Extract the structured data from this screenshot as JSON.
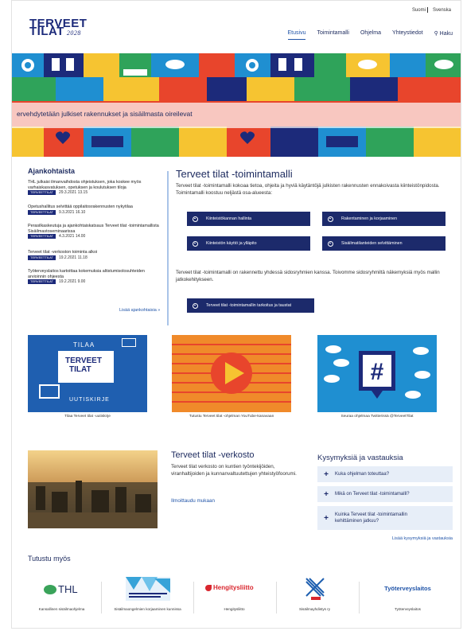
{
  "lang": {
    "fi": "Suomi",
    "sv": "Svenska"
  },
  "logo": {
    "line1": "TERVEET",
    "line2": "TILAT",
    "year": "2028"
  },
  "nav": {
    "items": [
      "Etusivu",
      "Toimintamalli",
      "Ohjelma",
      "Yhteystiedot"
    ],
    "search": "Haku",
    "search_icon": "search-icon"
  },
  "hero": {
    "tagline": "ervehdytetään julkiset rakennukset ja sisäilmasta oireilevat"
  },
  "news": {
    "title": "Ajankohtaista",
    "tag": "TERVEETTILAT",
    "items": [
      {
        "title": "THL julkaisi ilmanvaihdosta ohjeistuksen, joka koskee myös varhaiskasvatuksen, opetuksen ja koulutuksen tiloja",
        "date": "29.3.2021 13.15"
      },
      {
        "title": "Opetushallitus selvittää oppilaitosrakennusten nykytilaa",
        "date": "9.3.2021 16.10"
      },
      {
        "title": "Perasilkaskeutuja ja ajankohtaiskatsaus Terveet tilat -toimintamallista Sisäilmastoseminaarissa",
        "date": "4.3.2021 14.00"
      },
      {
        "title": "Terveet tilat -verkoston toiminta alkoi",
        "date": "19.2.2021 11.18"
      },
      {
        "title": "Työterveyslaitos kartoittaa kokemuksia altistumisolosuhteiden arvioinnin ohjeesta",
        "date": "19.2.2021 9.00"
      }
    ],
    "more": "Lisää ajankohtaisia »"
  },
  "toimintamalli": {
    "title": "Terveet tilat -toimintamalli",
    "intro": "Terveet tilat -toimintamalli kokoaa tietoa, ohjeita ja hyviä käytäntöjä julkisten rakennusten ennakoivasta kiinteistönpidosta. Toimintamalli koostuu neljästä osa-alueesta:",
    "buttons": [
      "Kiinteistökannan hallinta",
      "Rakentaminen ja korjaaminen",
      "Kiinteistön käyttö ja ylläpito",
      "Sisäilmatilanteiden selvittäminen"
    ],
    "text2": "Terveet tilat -toimintamalli on rakennettu yhdessä sidosryhmien kanssa. Toivomme sidosryhmiltä näkemyksiä myös mallin jatkokehitykseen.",
    "cta": "Terveet tilat -toimintamallin tarkoitus ja taustat"
  },
  "cards": [
    {
      "top": "TILAA",
      "mid1": "TERVEET",
      "mid2": "TILAT",
      "bottom": "UUTISKIRJE",
      "caption": "Tilaa Terveet tilat -uutiskirje"
    },
    {
      "caption": "Tutustu Terveet tilat -ohjelman YouTube-kanavaan"
    },
    {
      "caption": "Seuraa ohjelmaa Twitterissä @TerveetTilat"
    }
  ],
  "verkosto": {
    "title": "Terveet tilat -verkosto",
    "text": "Terveet tilat verkosto on kuntien työntekijöiden, viranhaltijoiden ja kunnanvaltuutettujen yhteistyöfoorumi.",
    "link": "Ilmoittaudu mukaan"
  },
  "faq": {
    "title": "Kysymyksiä ja vastauksia",
    "items": [
      "Kuka ohjelman toteuttaa?",
      "Mikä on Terveet tilat -toimintamalli?",
      "Kuinka Terveet tilat -toimintamallin kehittäminen jatkuu?"
    ],
    "more": "Lisää kysymyksiä ja vastauksia"
  },
  "tutustu": {
    "title": "Tutustu myös",
    "partners": [
      {
        "logo": "THL",
        "label": "Kansallinen sisäilmaohjelma"
      },
      {
        "logo": "",
        "label": "Sisäilmaongelmien korjaaminen kunnissa"
      },
      {
        "logo": "Hengitysliitto",
        "label": "Hengitysliitto"
      },
      {
        "logo": "",
        "label": "Sisäilmayhdistys ry"
      },
      {
        "logo": "Työterveyslaitos",
        "label": "Työterveyslaitos"
      }
    ]
  },
  "colors": {
    "navy": "#1c2a6b",
    "link": "#2054a8",
    "faq_bg": "#e7eef8"
  }
}
